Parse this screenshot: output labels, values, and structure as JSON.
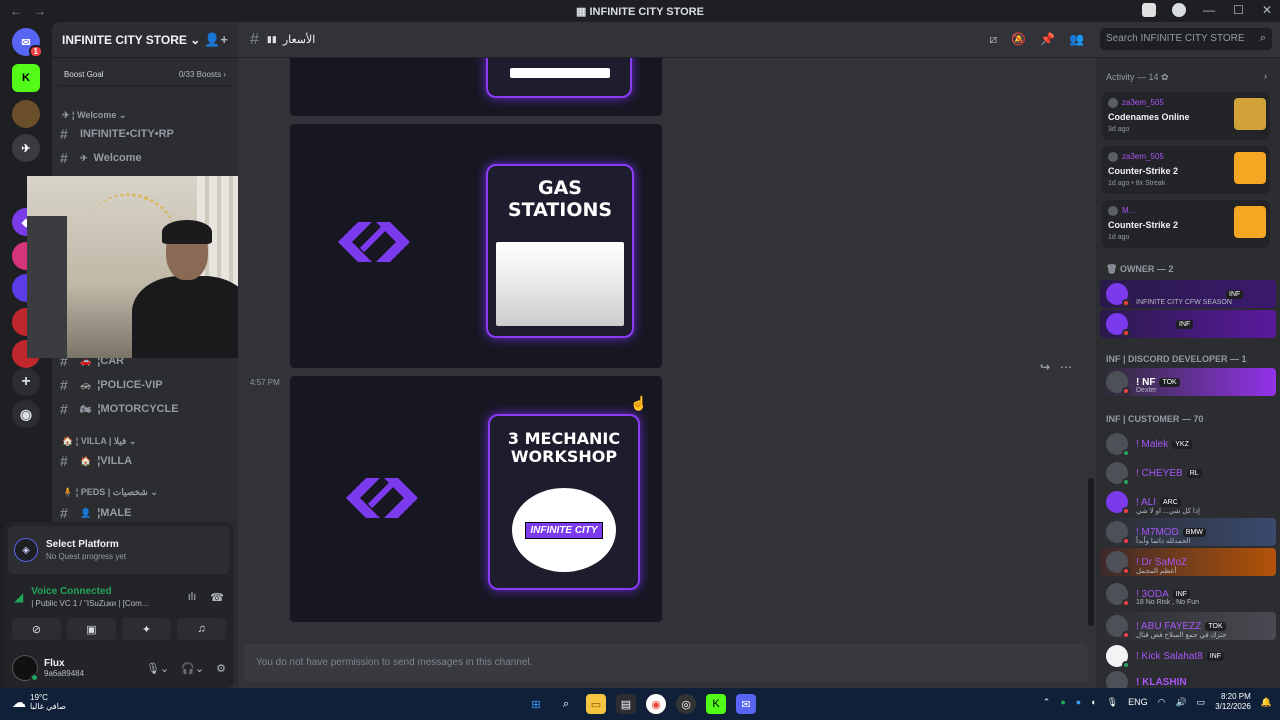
{
  "window": {
    "title": "INFINITE CITY STORE",
    "controls": [
      "—",
      "☐",
      "✕"
    ]
  },
  "guilds": [
    {
      "name": "discord-home",
      "badge": "1",
      "color": "#5865f2"
    },
    {
      "name": "kick",
      "color": "#53fc18"
    },
    {
      "name": "server-2",
      "color": "#6b4f2a"
    },
    {
      "name": "server-3",
      "color": "#e6e6e6"
    },
    {
      "name": "add-server",
      "color": "#2b2d31"
    },
    {
      "name": "discover",
      "color": "#2b2d31"
    }
  ],
  "server": {
    "name": "INFINITE CITY STORE",
    "boost_goal": "Boost Goal",
    "boost_count": "0/33 Boosts"
  },
  "channels": {
    "welcome_category": "Welcome",
    "items": [
      {
        "name": "INFINITE•CITY•RP"
      },
      {
        "name": "Welcome",
        "emoji": "✈"
      },
      {
        "name": "CAR",
        "emoji": "🚗"
      },
      {
        "name": "POLICE-VIP",
        "emoji": "🚓"
      },
      {
        "name": "MOTORCYCLE",
        "emoji": "🏍"
      }
    ],
    "villa_category": "VILLA | فيلا",
    "villa": "VILLA",
    "peds_category": "PEDS | شخصيات",
    "male": "MALE"
  },
  "quest": {
    "title": "Select Platform",
    "subtitle": "No Quest progress yet"
  },
  "voice": {
    "status": "Voice Connected",
    "channel": "| Public VC 1 / \"ISuZuки | [Com..."
  },
  "user": {
    "name": "Flux",
    "status": "9a6a89484"
  },
  "channel_header": {
    "name": "الأسعار"
  },
  "search": {
    "placeholder": "Search INFINITE CITY STORE"
  },
  "messages": {
    "card1_title": "GAS STATIONS",
    "timestamp": "4:57 PM",
    "card2_title": "3 MECHANIC WORKSHOP",
    "card2_logo_text": "INFINITE CITY",
    "composer": "You do not have permission to send messages in this channel."
  },
  "activity": {
    "header": "Activity — 14",
    "items": [
      {
        "user": "za3em_505",
        "game": "Codenames Online",
        "time": "3d ago",
        "color": "#d2a23a"
      },
      {
        "user": "za3em_505",
        "game": "Counter-Strike 2",
        "time": "1d ago  •  8x Streak",
        "color": "#f5a623"
      },
      {
        "user": "M...",
        "game": "Counter-Strike 2",
        "time": "1d ago",
        "color": "#f5a623"
      }
    ]
  },
  "members": {
    "owner_header": "OWNER — 2",
    "owners": [
      {
        "name": "",
        "tag": "INF",
        "sub": "INFINITE CITY CFW SEASON"
      },
      {
        "name": "",
        "tag": "INF"
      }
    ],
    "dev_header": "INF | DISCORD DEVELOPER — 1",
    "devs": [
      {
        "name": "! NF",
        "tag": "TOK",
        "sub": "Dexter"
      }
    ],
    "customer_header": "INF | CUSTOMER — 70",
    "customers": [
      {
        "name": "! Malek",
        "tag": "YKZ"
      },
      {
        "name": "! CHEYEB",
        "tag": "RL"
      },
      {
        "name": "! ALI",
        "tag": "ARC",
        "sub": "إذا كل شي... او لا شي"
      },
      {
        "name": "! M7MOD",
        "tag": "BMW",
        "sub": "الحمدلله دائما وأبدأ"
      },
      {
        "name": "! Dr SaMoZ",
        "sub": "أعظم المجمل"
      },
      {
        "name": "! 3ODA",
        "tag": "INF",
        "sub": "18 No Risk , No Fun"
      },
      {
        "name": "! ABU FAYEZZ",
        "tag": "TOK",
        "sub": "حترك في جمع السلاح فض قتال"
      },
      {
        "name": "! Kick Salahat8",
        "tag": "INF"
      },
      {
        "name": "! KLASHIN"
      }
    ]
  },
  "taskbar": {
    "temp": "19°C",
    "weather": "صافي غالبا",
    "lang": "ENG",
    "time": "8:20 PM",
    "date": "3/12/2026"
  }
}
